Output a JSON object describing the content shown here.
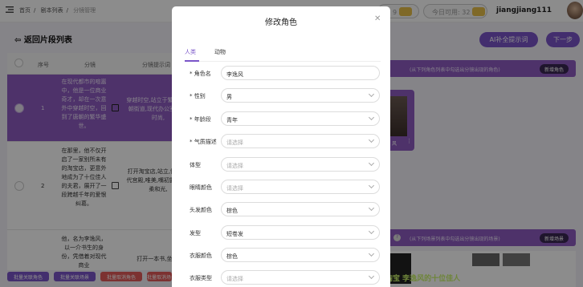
{
  "breadcrumb": [
    "首页",
    "剧本列表",
    "分镜管理"
  ],
  "top": {
    "pill1": "：9",
    "pill2": "今日可用: 32",
    "username": "jiangjiang111"
  },
  "back_label": "返回片段列表",
  "actions": {
    "ai_prompt": "AI补全提示词",
    "next": "下一步"
  },
  "table": {
    "headers": [
      "序号",
      "分镜",
      "分镜提示词"
    ],
    "rows": [
      {
        "index": "1",
        "segment": "在现代都市的喧嚣中，他是一位商业奇才，却在一次意外中穿越时空，回到了唐朝的繁华盛世。",
        "prompt": "穿越时空,站立于繁华的唐朝街道,现代办公室,现代时尚,"
      },
      {
        "index": "2",
        "segment": "在那里，他不仅开启了一家别所未有的淘宝店，更意外地成为了十位佳人的夫君，展开了一段跨越千年的爱恨纠葛。",
        "prompt": "打开淘宝店,站立,惊讶,古代宫殿,唯美,嘴初露,特写,柔和光,"
      },
      {
        "index": "",
        "segment": "他，名为李逸风，以一介书生的身份，凭借着对现代商业",
        "prompt": "打开一本书,坐着,"
      }
    ]
  },
  "bottom_buttons": [
    "批量关联角色",
    "批量关联场景",
    "批量取消角色",
    "批量取消场景"
  ],
  "right": {
    "hint1": "(从下列角色列表中勾选出分镜出现的角色)",
    "add_role": "新增角色",
    "thumb_caption": "风",
    "hint2": "(从下列场景列表中勾选出分镜出现的场景)",
    "add_scene": "新增场景",
    "subtitle": "淘宝 李逸风的十位佳人"
  },
  "modal": {
    "title": "修改角色",
    "tabs": [
      "人类",
      "动物"
    ],
    "fields": [
      {
        "label": "* 角色名",
        "value": "李逸风",
        "placeholder": false
      },
      {
        "label": "* 性别",
        "value": "男",
        "placeholder": false
      },
      {
        "label": "* 年龄段",
        "value": "青年",
        "placeholder": false
      },
      {
        "label": "* 气质描述",
        "value": "请选择",
        "placeholder": true
      },
      {
        "label": "体型",
        "value": "请选择",
        "placeholder": true
      },
      {
        "label": "眼睛颜色",
        "value": "请选择",
        "placeholder": true
      },
      {
        "label": "头发颜色",
        "value": "棕色",
        "placeholder": false
      },
      {
        "label": "发型",
        "value": "短卷发",
        "placeholder": false
      },
      {
        "label": "衣服颜色",
        "value": "棕色",
        "placeholder": false
      },
      {
        "label": "衣服类型",
        "value": "请选择",
        "placeholder": true
      }
    ]
  },
  "colors": {
    "accent": "#7a55c8",
    "row_selected": "#8e5bc2"
  }
}
